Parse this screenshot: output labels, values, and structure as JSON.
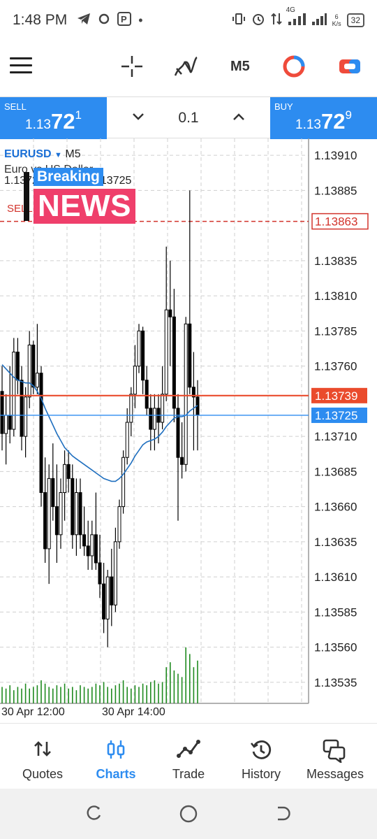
{
  "status_bar": {
    "time": "1:48 PM",
    "network": "4G",
    "speed_value": "6",
    "speed_unit": "K/s",
    "battery": "32"
  },
  "toolbar": {
    "timeframe": "M5"
  },
  "order_bar": {
    "sell_label": "SELL",
    "sell_price_prefix": "1.13",
    "sell_price_big": "72",
    "sell_price_sup": "1",
    "buy_label": "BUY",
    "buy_price_prefix": "1.13",
    "buy_price_big": "72",
    "buy_price_sup": "9",
    "volume": "0.1"
  },
  "chart_header": {
    "symbol": "EURUSD",
    "timeframe": "M5",
    "subtitle": "Euro vs US Dollar",
    "ohlc": "1.13725 1.13700 1.13725",
    "sell_tag": "SELL"
  },
  "news_overlay": {
    "breaking": "Breaking",
    "news": "NEWS"
  },
  "colors": {
    "accent": "#2d8cf0",
    "bear_candle": "#000000",
    "bull_candle": "#000000",
    "ma_line": "#1f6fbf",
    "bid_line": "#ea4b2c",
    "ask_line": "#2d8cf0",
    "sell_level": "#d2332b",
    "volume_bar": "#1f8a1f"
  },
  "chart_data": {
    "type": "candlestick",
    "symbol": "EURUSD",
    "timeframe": "M5",
    "y_axis_ticks": [
      "1.13910",
      "1.13885",
      "1.13835",
      "1.13810",
      "1.13785",
      "1.13760",
      "1.13710",
      "1.13685",
      "1.13660",
      "1.13635",
      "1.13610",
      "1.13585",
      "1.13560",
      "1.13535"
    ],
    "ylim": [
      1.1352,
      1.13922
    ],
    "price_labels": {
      "sell_level": "1.13863",
      "bid": "1.13739",
      "ask": "1.13725"
    },
    "x_tick_labels": [
      "30 Apr 12:00",
      "30 Apr 14:00"
    ],
    "grid": true,
    "candles": [
      [
        1.13742,
        1.1376,
        1.137,
        1.13712
      ],
      [
        1.13712,
        1.1374,
        1.1369,
        1.13725
      ],
      [
        1.13725,
        1.1376,
        1.13705,
        1.13715
      ],
      [
        1.13715,
        1.1378,
        1.1371,
        1.1377
      ],
      [
        1.1377,
        1.1378,
        1.1374,
        1.1375
      ],
      [
        1.1375,
        1.1376,
        1.137,
        1.1371
      ],
      [
        1.1371,
        1.13745,
        1.13695,
        1.13738
      ],
      [
        1.13738,
        1.13785,
        1.1373,
        1.13775
      ],
      [
        1.13775,
        1.13778,
        1.1374,
        1.13745
      ],
      [
        1.13745,
        1.1379,
        1.1374,
        1.13755
      ],
      [
        1.13755,
        1.1376,
        1.1366,
        1.1367
      ],
      [
        1.1367,
        1.13695,
        1.1362,
        1.1363
      ],
      [
        1.1363,
        1.1369,
        1.13605,
        1.1368
      ],
      [
        1.1368,
        1.13705,
        1.1365,
        1.1366
      ],
      [
        1.1366,
        1.1369,
        1.1362,
        1.1364
      ],
      [
        1.1364,
        1.1368,
        1.1363,
        1.1367
      ],
      [
        1.1367,
        1.137,
        1.1365,
        1.1369
      ],
      [
        1.1369,
        1.137,
        1.1367,
        1.1368
      ],
      [
        1.1368,
        1.1369,
        1.1363,
        1.1364
      ],
      [
        1.1364,
        1.1368,
        1.13625,
        1.1367
      ],
      [
        1.1367,
        1.1368,
        1.1363,
        1.1364
      ],
      [
        1.1364,
        1.1366,
        1.13625,
        1.13632
      ],
      [
        1.13632,
        1.1365,
        1.13615,
        1.13625
      ],
      [
        1.13625,
        1.1365,
        1.13615,
        1.1364
      ],
      [
        1.1364,
        1.1367,
        1.13615,
        1.1362
      ],
      [
        1.1362,
        1.1364,
        1.13595,
        1.13605
      ],
      [
        1.13605,
        1.1362,
        1.1357,
        1.1358
      ],
      [
        1.1358,
        1.13615,
        1.1356,
        1.1361
      ],
      [
        1.1361,
        1.1363,
        1.13575,
        1.1359
      ],
      [
        1.1359,
        1.13645,
        1.13585,
        1.13635
      ],
      [
        1.13635,
        1.13665,
        1.1363,
        1.1366
      ],
      [
        1.1366,
        1.137,
        1.13655,
        1.13695
      ],
      [
        1.13695,
        1.1373,
        1.1369,
        1.1372
      ],
      [
        1.1372,
        1.13745,
        1.1371,
        1.1374
      ],
      [
        1.1374,
        1.13775,
        1.1373,
        1.1376
      ],
      [
        1.1376,
        1.1379,
        1.13755,
        1.13785
      ],
      [
        1.13785,
        1.13788,
        1.1374,
        1.1375
      ],
      [
        1.1375,
        1.1376,
        1.13725,
        1.1373
      ],
      [
        1.1373,
        1.1374,
        1.137,
        1.13715
      ],
      [
        1.13715,
        1.1374,
        1.137,
        1.1373
      ],
      [
        1.1373,
        1.1374,
        1.13705,
        1.1372
      ],
      [
        1.1372,
        1.1376,
        1.13715,
        1.1374
      ],
      [
        1.1374,
        1.13845,
        1.13735,
        1.138
      ],
      [
        1.138,
        1.13835,
        1.1376,
        1.13795
      ],
      [
        1.13795,
        1.13815,
        1.1372,
        1.1373
      ],
      [
        1.1373,
        1.1374,
        1.1365,
        1.13695
      ],
      [
        1.13695,
        1.1372,
        1.1368,
        1.1369
      ],
      [
        1.1369,
        1.13795,
        1.13685,
        1.1379
      ],
      [
        1.1379,
        1.13885,
        1.1374,
        1.13745
      ],
      [
        1.13745,
        1.1377,
        1.137,
        1.13738
      ],
      [
        1.13738,
        1.1375,
        1.137,
        1.13725
      ]
    ],
    "moving_average": [
      1.13761,
      1.13758,
      1.13755,
      1.13752,
      1.1375,
      1.13749,
      1.13748,
      1.13748,
      1.13746,
      1.13742,
      1.13737,
      1.1373,
      1.13724,
      1.13718,
      1.13712,
      1.13707,
      1.13702,
      1.13699,
      1.13696,
      1.13694,
      1.13692,
      1.1369,
      1.13688,
      1.13686,
      1.13684,
      1.13682,
      1.1368,
      1.13679,
      1.13678,
      1.13678,
      1.1368,
      1.13683,
      1.13687,
      1.13691,
      1.13696,
      1.137,
      1.13704,
      1.13706,
      1.13707,
      1.13708,
      1.1371,
      1.13713,
      1.13717,
      1.1372,
      1.13723,
      1.13724,
      1.13724,
      1.13725,
      1.13728,
      1.1373,
      1.13732
    ],
    "volumes": [
      10,
      9,
      11,
      8,
      10,
      9,
      12,
      9,
      10,
      11,
      14,
      12,
      10,
      9,
      11,
      10,
      12,
      9,
      10,
      8,
      11,
      10,
      9,
      10,
      12,
      11,
      13,
      10,
      9,
      11,
      12,
      14,
      10,
      9,
      11,
      10,
      12,
      11,
      13,
      14,
      12,
      13,
      22,
      25,
      20,
      18,
      16,
      34,
      30,
      22,
      26
    ]
  },
  "bottom_nav": {
    "quotes": "Quotes",
    "charts": "Charts",
    "trade": "Trade",
    "history": "History",
    "messages": "Messages"
  }
}
